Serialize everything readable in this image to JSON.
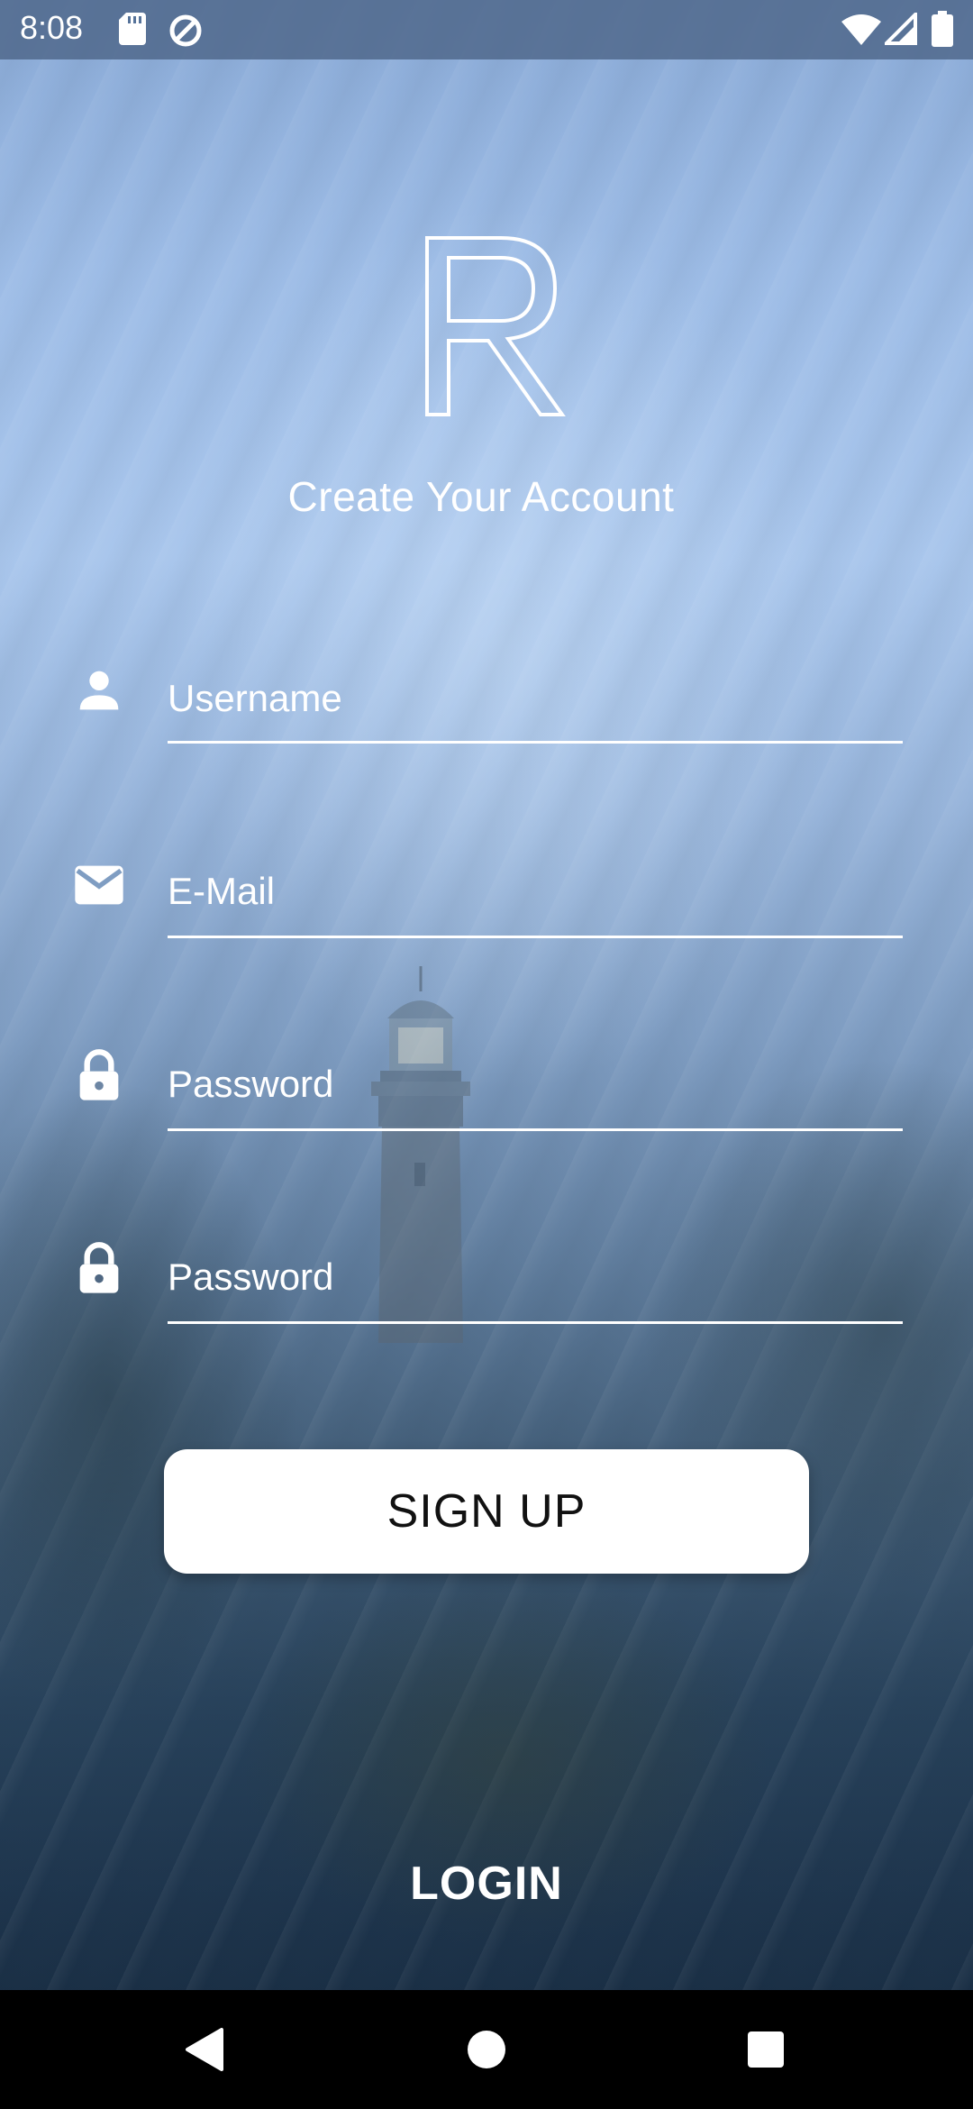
{
  "status_bar": {
    "time": "8:08",
    "icons": [
      "sd-card-icon",
      "data-saver-icon",
      "wifi-icon",
      "signal-icon",
      "battery-icon"
    ]
  },
  "logo": {
    "letter": "R"
  },
  "title": "Create Your Account",
  "form": {
    "username": {
      "placeholder": "Username",
      "value": "",
      "icon": "person-icon"
    },
    "email": {
      "placeholder": "E-Mail",
      "value": "",
      "icon": "email-icon"
    },
    "password": {
      "placeholder": "Password",
      "value": "",
      "icon": "lock-icon"
    },
    "confirm_password": {
      "placeholder": "Password",
      "value": "",
      "icon": "lock-icon"
    }
  },
  "buttons": {
    "signup_label": "SIGN UP",
    "login_label": "LOGIN"
  },
  "nav_bar": {
    "icons": [
      "back-icon",
      "home-icon",
      "recents-icon"
    ]
  },
  "colors": {
    "text": "#ffffff",
    "button_bg": "#ffffff",
    "button_text": "#111111",
    "nav_bg": "#000000"
  }
}
